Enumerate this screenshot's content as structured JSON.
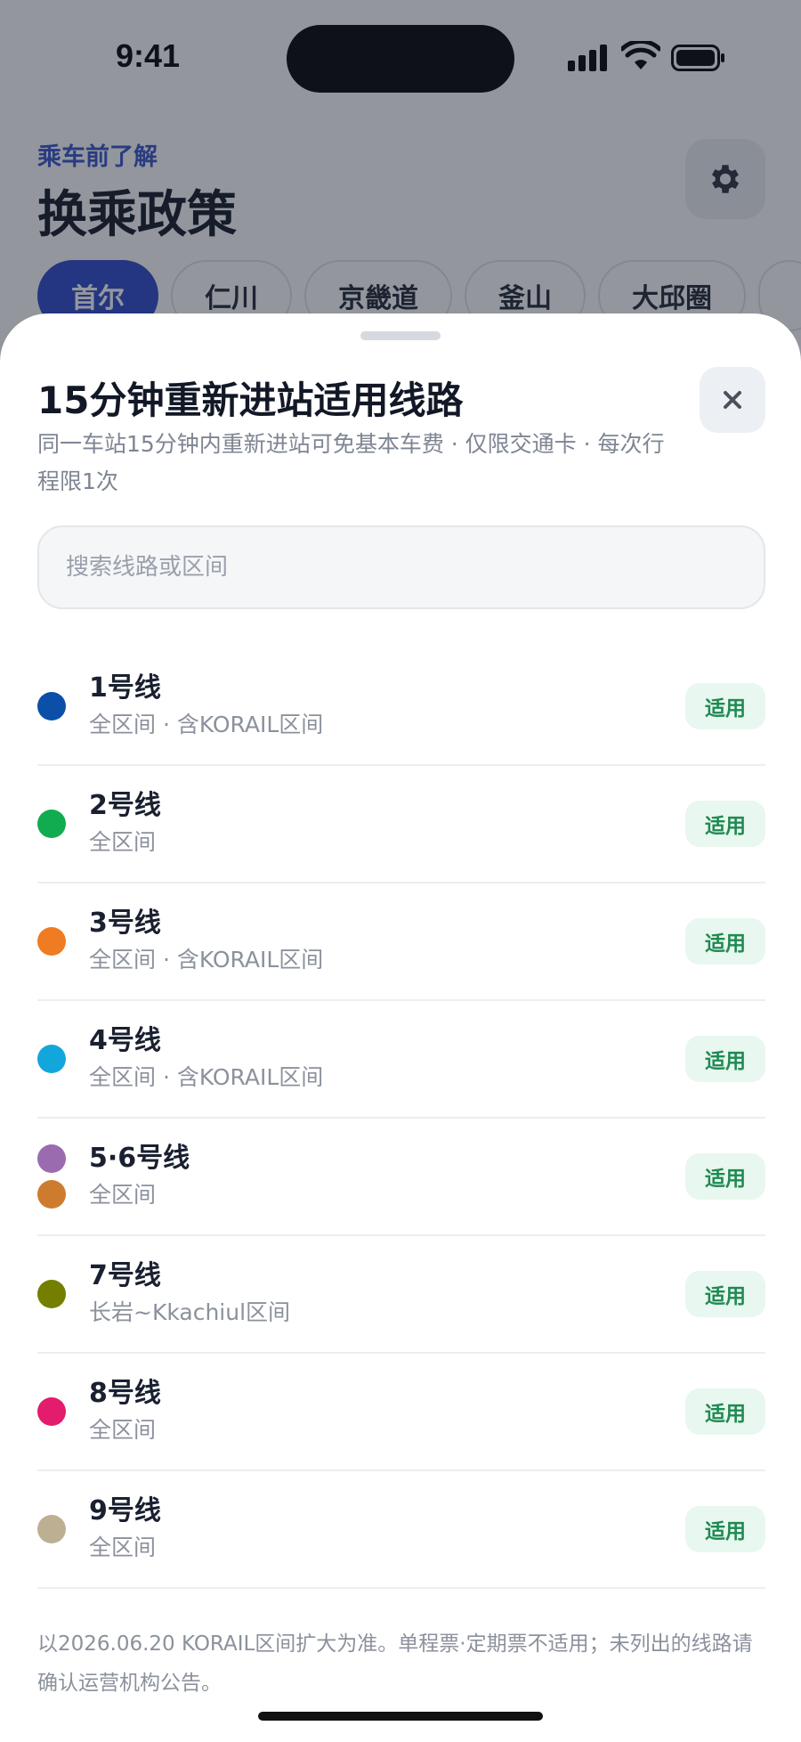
{
  "status_bar": {
    "time": "9:41"
  },
  "header": {
    "pre_title": "乘车前了解",
    "title": "换乘政策"
  },
  "tabs": [
    {
      "label": "首尔",
      "active": true
    },
    {
      "label": "仁川"
    },
    {
      "label": "京畿道"
    },
    {
      "label": "釜山"
    },
    {
      "label": "大邱圈"
    }
  ],
  "sheet": {
    "title": "15分钟重新进站适用线路",
    "subtitle": "同一车站15分钟内重新进站可免基本车费 · 仅限交通卡 · 每次行程限1次",
    "search_placeholder": "搜索线路或区间",
    "lines": [
      {
        "name": "1号线",
        "desc": "全区间 · 含KORAIL区间",
        "badge": "适用",
        "colors": [
          "#0b4fa8"
        ]
      },
      {
        "name": "2号线",
        "desc": "全区间",
        "badge": "适用",
        "colors": [
          "#11ac4f"
        ]
      },
      {
        "name": "3号线",
        "desc": "全区间 · 含KORAIL区间",
        "badge": "适用",
        "colors": [
          "#ef7b22"
        ]
      },
      {
        "name": "4号线",
        "desc": "全区间 · 含KORAIL区间",
        "badge": "适用",
        "colors": [
          "#12a6dd"
        ]
      },
      {
        "name": "5·6号线",
        "desc": "全区间",
        "badge": "适用",
        "colors": [
          "#9b6bb0",
          "#cd7c2f"
        ]
      },
      {
        "name": "7号线",
        "desc": "长岩~Kkachiul区间",
        "badge": "适用",
        "colors": [
          "#747f00"
        ]
      },
      {
        "name": "8号线",
        "desc": "全区间",
        "badge": "适用",
        "colors": [
          "#e31c6d"
        ]
      },
      {
        "name": "9号线",
        "desc": "全区间",
        "badge": "适用",
        "colors": [
          "#bdb092"
        ]
      }
    ],
    "footer_note": "以2026.06.20 KORAIL区间扩大为准。单程票·定期票不适用；未列出的线路请确认运营机构公告。"
  },
  "icons": {
    "settings": "gear-icon",
    "close": "close-icon",
    "signal": "signal-icon",
    "wifi": "wifi-icon",
    "battery": "battery-icon"
  }
}
